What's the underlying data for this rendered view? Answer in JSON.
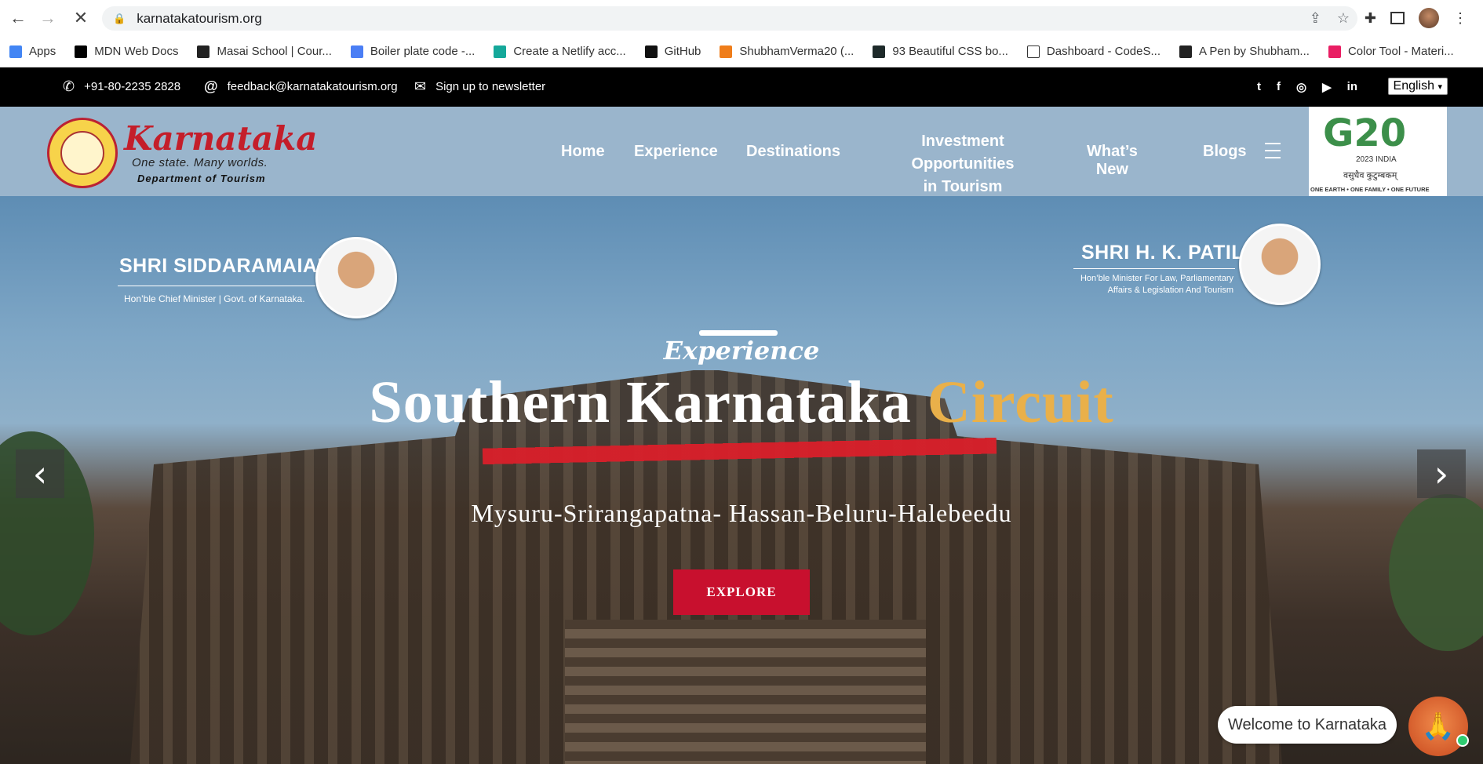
{
  "browser": {
    "url": "karnatakatourism.org",
    "bookmarks": [
      {
        "label": "Apps",
        "color": "#4285f4"
      },
      {
        "label": "MDN Web Docs",
        "color": "#000000"
      },
      {
        "label": "Masai School | Cour...",
        "color": "#222222"
      },
      {
        "label": "Boiler plate code -...",
        "color": "#4a7ef5"
      },
      {
        "label": "Create a Netlify acc...",
        "color": "#15a89a"
      },
      {
        "label": "GitHub",
        "color": "#111111"
      },
      {
        "label": "ShubhamVerma20 (...",
        "color": "#ef7d1a"
      },
      {
        "label": "93 Beautiful CSS bo...",
        "color": "#1e2a2a"
      },
      {
        "label": "Dashboard - CodeS...",
        "color": "#ffffff"
      },
      {
        "label": "A Pen by Shubham...",
        "color": "#222222"
      },
      {
        "label": "Color Tool - Materi...",
        "color": "#e91e63"
      }
    ]
  },
  "topbar": {
    "phone": "+91-80-2235 2828",
    "email": "feedback@karnatakatourism.org",
    "newsletter": "Sign up to newsletter",
    "language": "English"
  },
  "header": {
    "logo_word": "Karnataka",
    "logo_tagline": "One state. Many worlds.",
    "logo_dept": "Department of Tourism",
    "nav": {
      "home": "Home",
      "experience": "Experience",
      "destinations": "Destinations",
      "investment_line1": "Investment Opportunities",
      "investment_line2": "in Tourism",
      "whats_new": "What’s New",
      "blogs": "Blogs"
    },
    "g20": {
      "mark": "G20",
      "india": "2023 INDIA",
      "hindi": "वसुधैव कुटुम्बकम्",
      "footer": "ONE EARTH • ONE FAMILY • ONE FUTURE"
    }
  },
  "hero": {
    "minister_left": {
      "name": "SHRI SIDDARAMAIAH",
      "role": "Hon’ble Chief Minister | Govt. of Karnataka."
    },
    "minister_right": {
      "name": "SHRI H. K. PATIL",
      "role_line1": "Hon’ble Minister For Law, Parliamentary",
      "role_line2": "Affairs & Legislation And Tourism"
    },
    "kicker": "Experience",
    "title_main": "Southern Karnataka ",
    "title_accent": "Circuit",
    "subtitle": "Mysuru-Srirangapatna- Hassan-Beluru-Halebeedu",
    "cta": "EXPLORE"
  },
  "chat": {
    "bubble": "Welcome to Karnataka"
  },
  "colors": {
    "topbar_bg": "#000000",
    "accent_gold": "#e9b04a",
    "cta_red": "#c8102e",
    "logo_red": "#c41e2a"
  }
}
